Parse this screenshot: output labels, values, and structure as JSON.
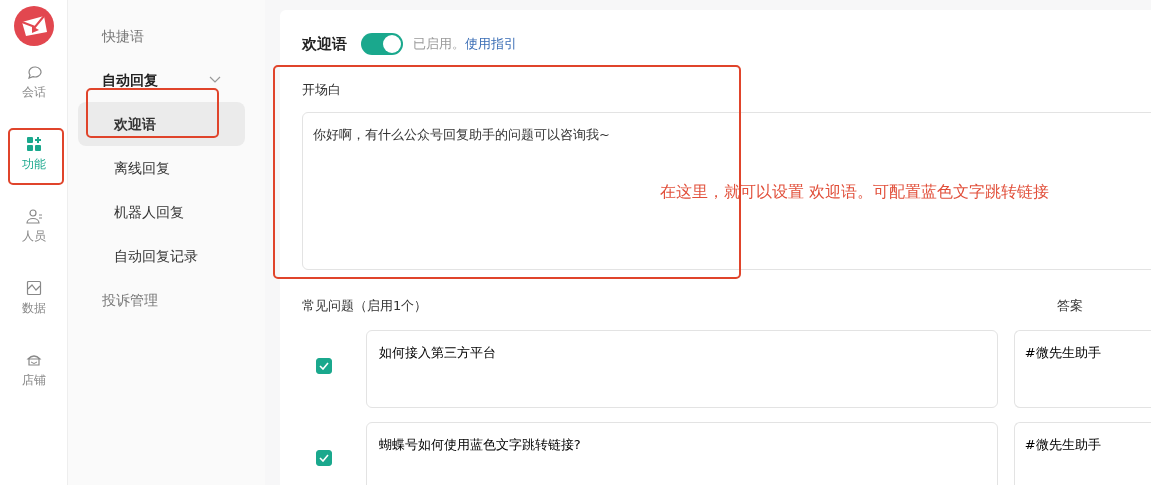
{
  "rail": {
    "items": [
      {
        "label": "会话",
        "selected": false
      },
      {
        "label": "功能",
        "selected": true
      },
      {
        "label": "人员",
        "selected": false
      },
      {
        "label": "数据",
        "selected": false
      },
      {
        "label": "店铺",
        "selected": false
      }
    ]
  },
  "submenu": {
    "items": [
      {
        "label": "快捷语",
        "selected": false
      },
      {
        "label": "自动回复",
        "expanded": true,
        "selected": false,
        "children": [
          {
            "label": "欢迎语",
            "selected": true
          },
          {
            "label": "离线回复",
            "selected": false
          },
          {
            "label": "机器人回复",
            "selected": false
          },
          {
            "label": "自动回复记录",
            "selected": false
          }
        ]
      },
      {
        "label": "投诉管理",
        "selected": false
      }
    ]
  },
  "main": {
    "title": "欢迎语",
    "toggle": {
      "on": true
    },
    "status": "已启用。",
    "guide_link": "使用指引",
    "opening": {
      "label": "开场白",
      "value": "你好啊，有什么公众号回复助手的问题可以咨询我~"
    },
    "annotation": "在这里，就可以设置 欢迎语。可配置蓝色文字跳转链接",
    "faq": {
      "heading": "常见问题（启用1个）",
      "answer_heading": "答案",
      "rows": [
        {
          "checked": true,
          "question": "如何接入第三方平台",
          "answer": "#微先生助手"
        },
        {
          "checked": true,
          "question": "蝴蝶号如何使用蓝色文字跳转链接?",
          "answer": "#微先生助手"
        }
      ]
    }
  }
}
